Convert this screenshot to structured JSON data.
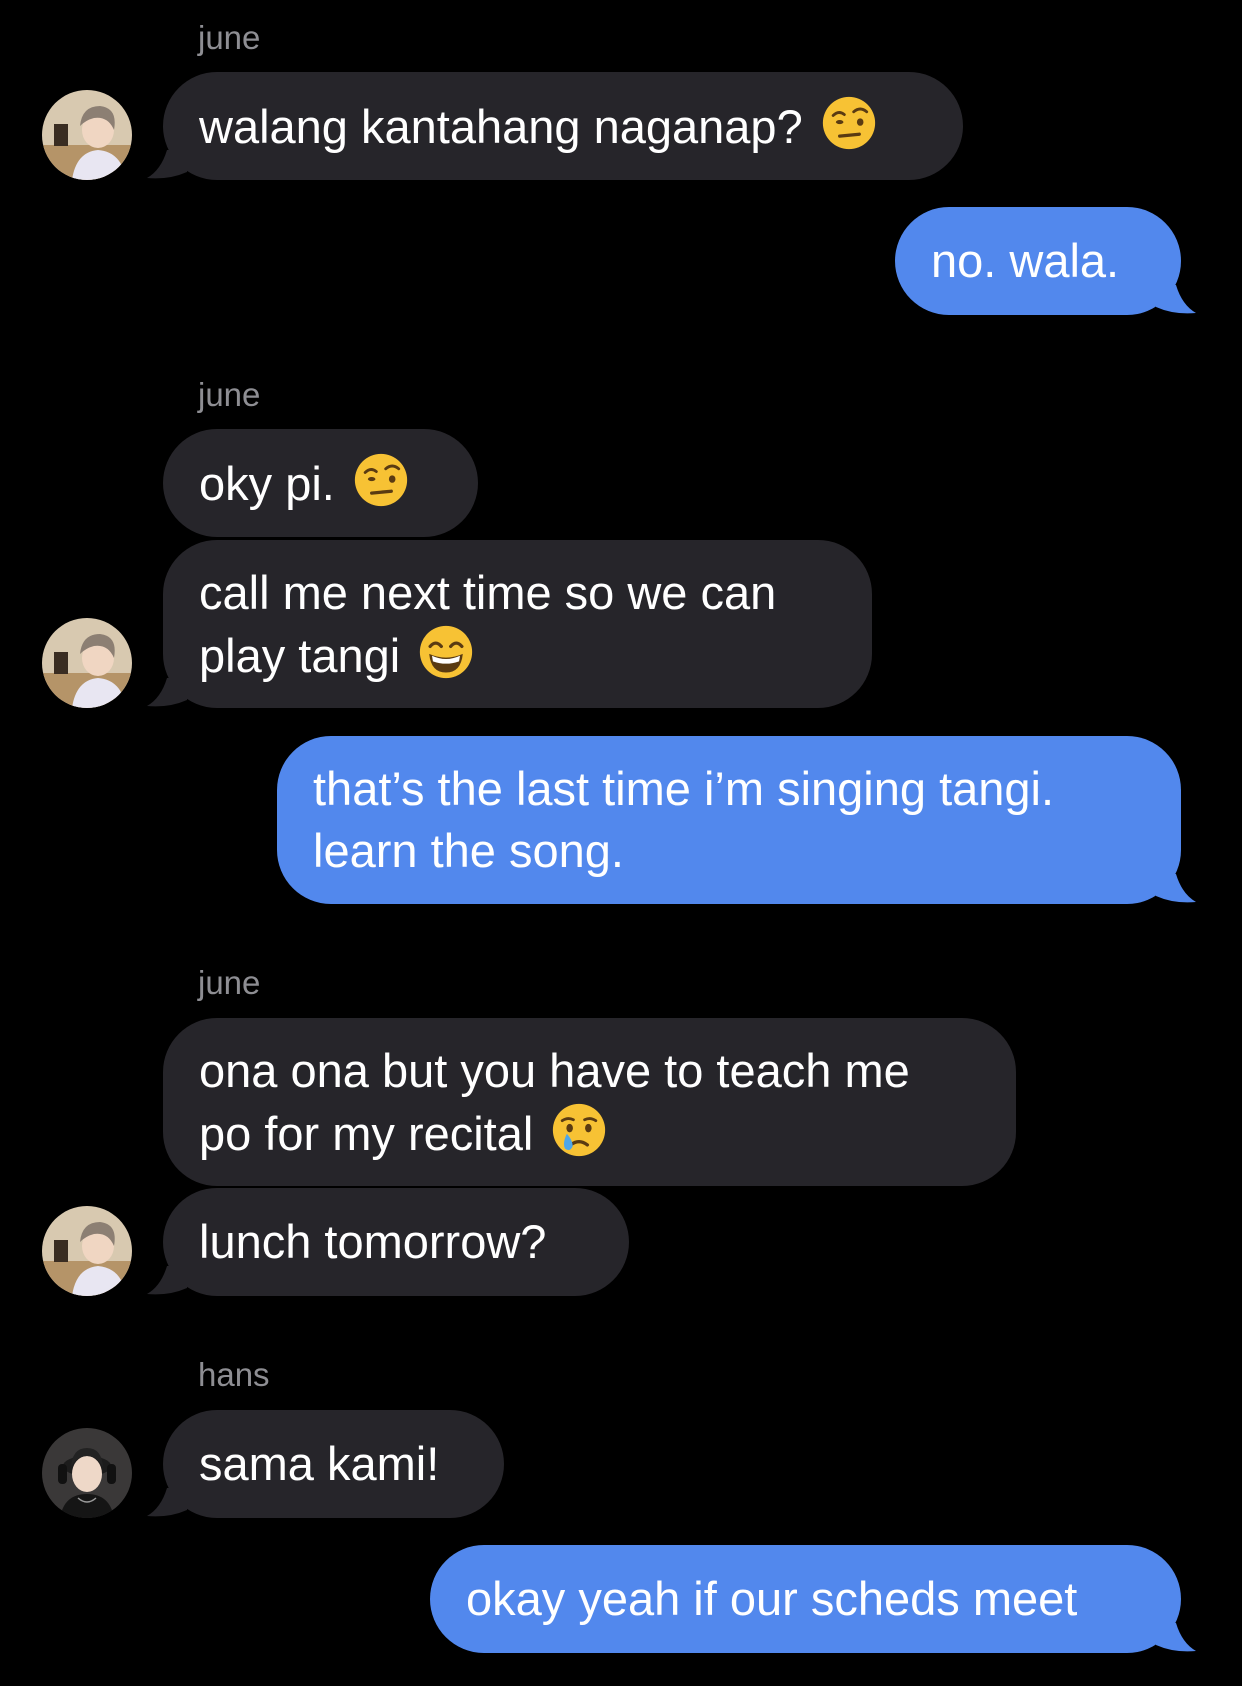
{
  "colors": {
    "background": "#000000",
    "incoming_bubble": "#26252a",
    "outgoing_bubble": "#5288ed",
    "sender_name": "#8e8e93",
    "text": "#ffffff"
  },
  "messages": [
    {
      "sender": "june",
      "text": "walang kantahang naganap?",
      "emoji": "face-with-raised-eyebrow"
    },
    {
      "text": "no. wala."
    },
    {
      "sender": "june",
      "text": "oky pi.",
      "emoji": "face-with-raised-eyebrow"
    },
    {
      "line1": "call me next time so we can",
      "line2": "play tangi",
      "emoji": "beaming-face-with-smiling-eyes"
    },
    {
      "line1": "that’s the last time i’m singing tangi.",
      "line2": "learn the song."
    },
    {
      "sender": "june",
      "line1": "ona ona but you have to teach me",
      "line2": "po for my recital",
      "emoji": "crying-face"
    },
    {
      "text": "lunch tomorrow?"
    },
    {
      "sender": "hans",
      "text": "sama kami!"
    },
    {
      "text": "okay yeah if our scheds meet"
    }
  ]
}
